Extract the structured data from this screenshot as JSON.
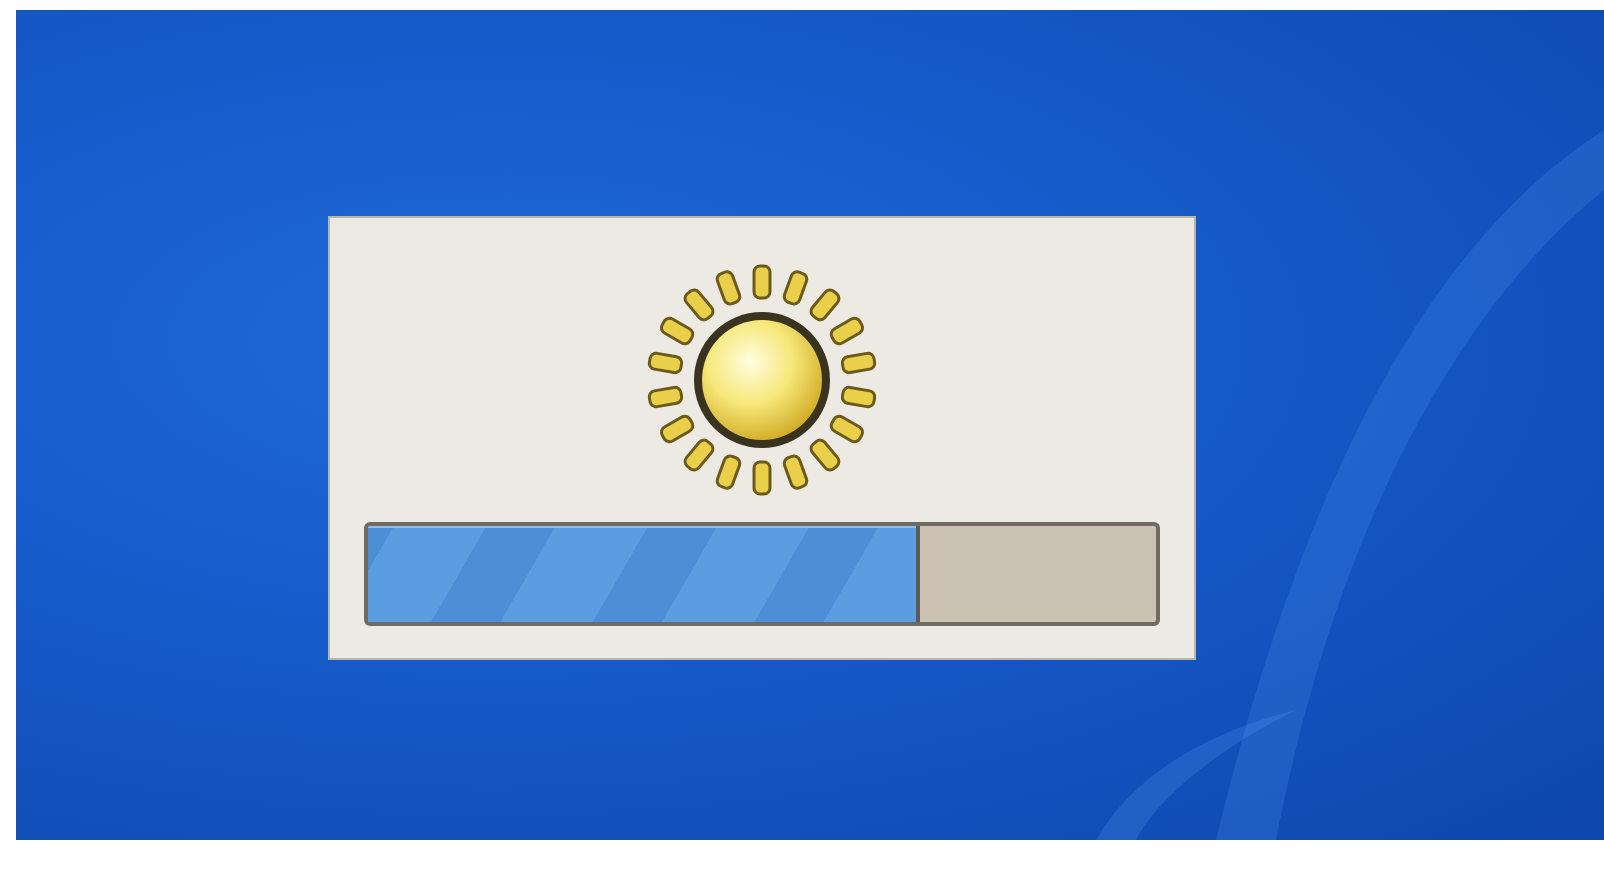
{
  "brightness_popup": {
    "kind": "brightness",
    "level": 0.7
  }
}
